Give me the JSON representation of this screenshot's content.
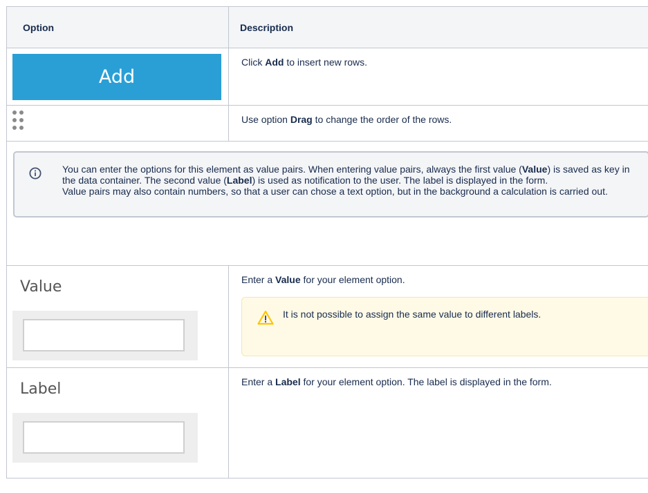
{
  "table": {
    "header": {
      "option": "Option",
      "description": "Description"
    },
    "rows": [
      {
        "button_label": "Add",
        "desc_pre": "Click ",
        "desc_bold": "Add",
        "desc_post": " to insert new rows."
      },
      {
        "icon": "drag-handle-icon",
        "desc_pre": "Use option ",
        "desc_bold": "Drag",
        "desc_post": " to change the order of the rows."
      }
    ],
    "info": {
      "icon": "info-icon",
      "t1": "You can enter the options for this element as value pairs. When entering value pairs, always the first value (",
      "b1": "Value",
      "t2": ") is saved as key in the data container. The second value (",
      "b2": "Label",
      "t3": ") is used as notification to the user. The label is displayed in the form.",
      "t4": "Value pairs may also contain numbers, so that a user can chose a text option, but in the background a calculation is carried out."
    },
    "value_row": {
      "field_label": "Value",
      "desc_pre": "Enter a ",
      "desc_bold": "Value",
      "desc_post": " for your element option.",
      "warning": {
        "icon": "warning-icon",
        "text": "It is not possible to assign the same value to different labels."
      }
    },
    "label_row": {
      "field_label": "Label",
      "desc_pre": "Enter a ",
      "desc_bold": "Label",
      "desc_post": " for your element option. The label is displayed in the form."
    }
  },
  "colors": {
    "add_button": "#2a9fd6",
    "header_bg": "#f4f5f7",
    "info_bg": "#f4f5f7",
    "warning_bg": "#fffae6",
    "warning_icon": "#ffc400"
  }
}
